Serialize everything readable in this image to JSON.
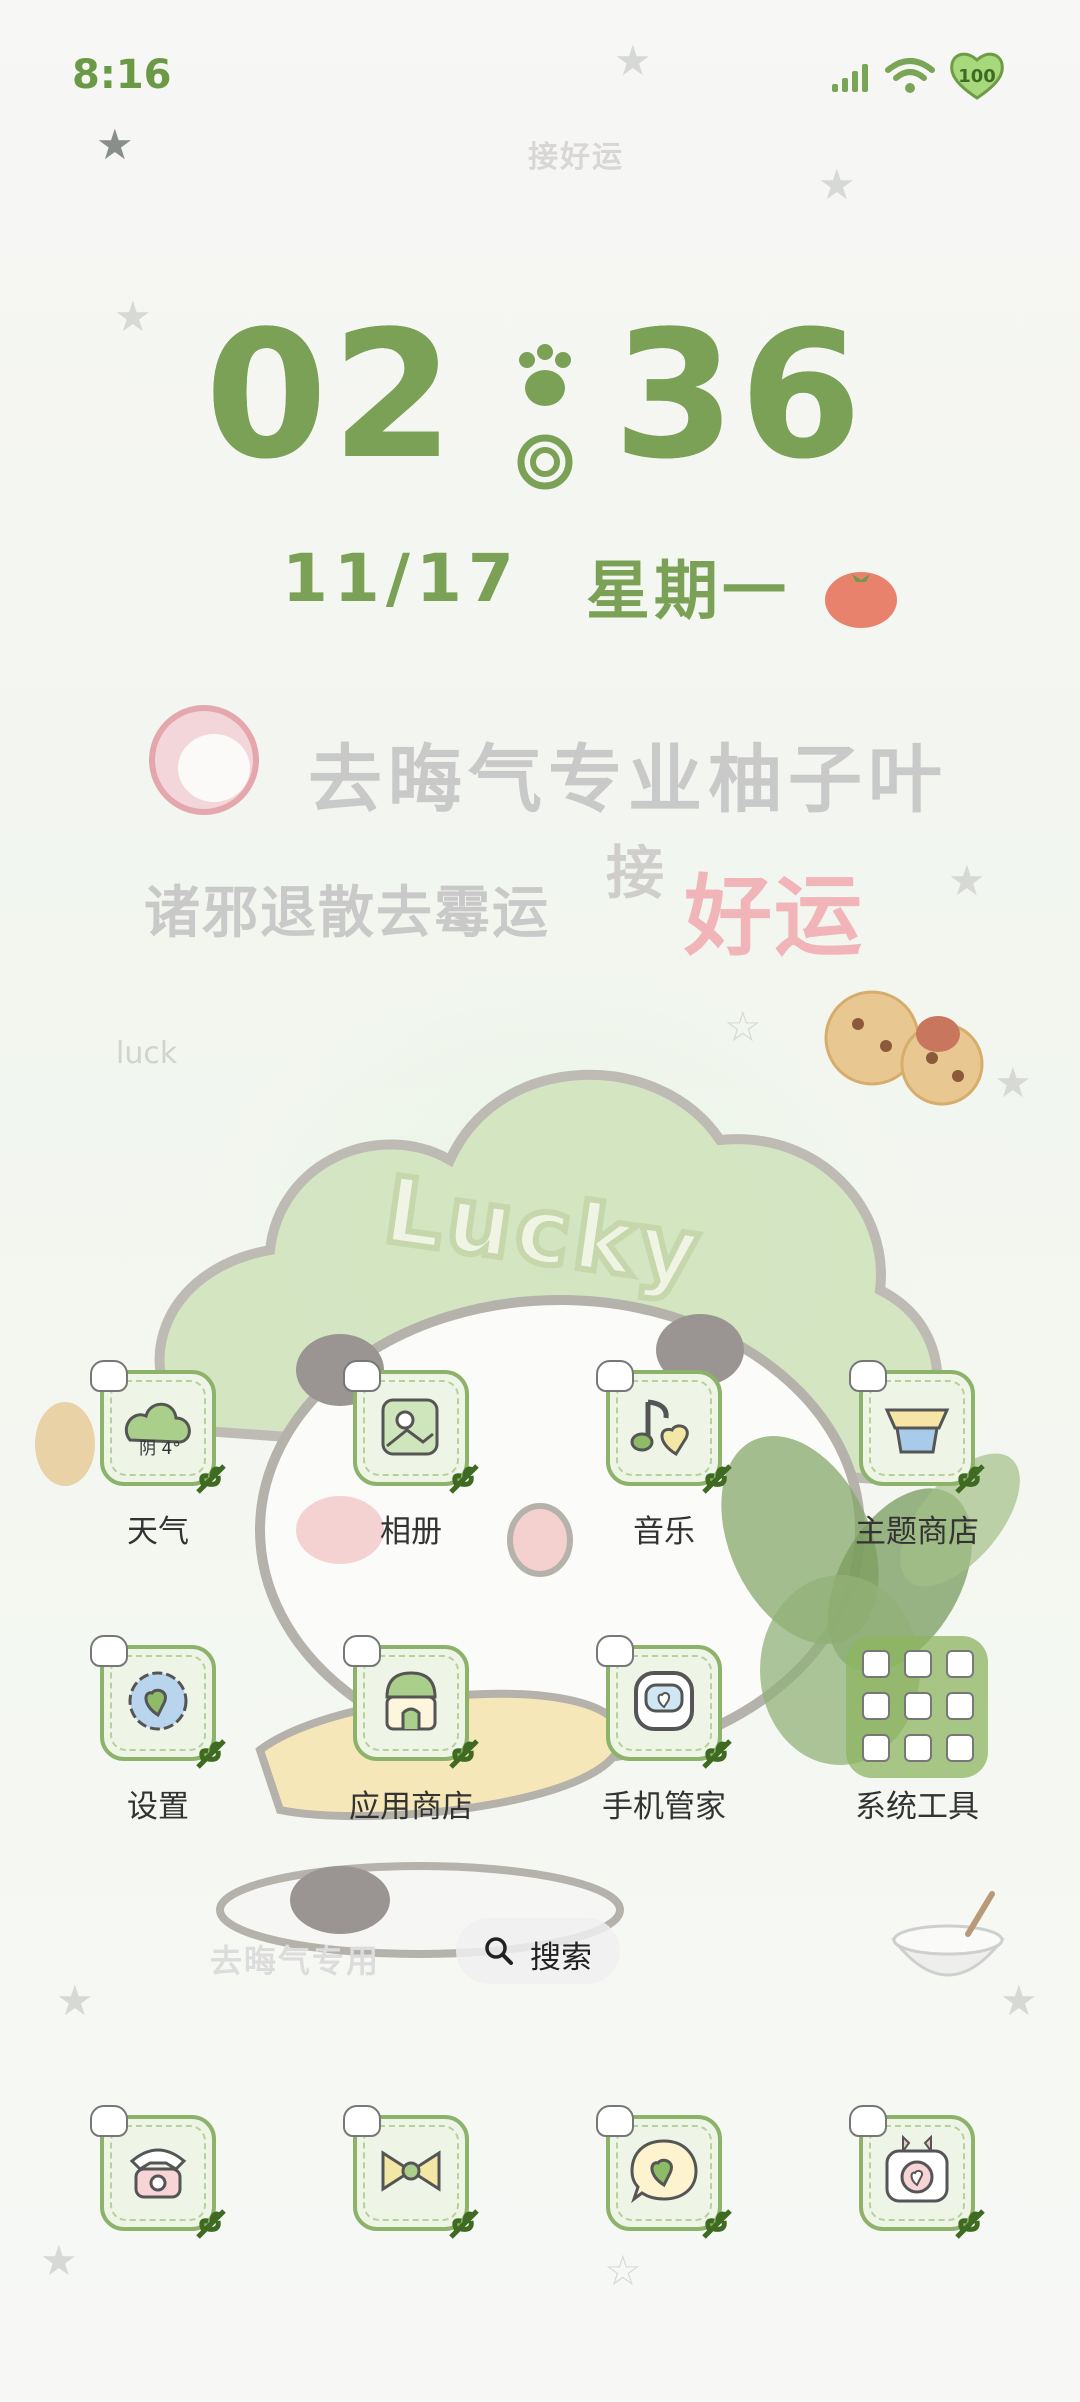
{
  "status_bar": {
    "time": "8:16",
    "battery": "100"
  },
  "wallpaper": {
    "top_text": "接好运",
    "line1": "去晦气专业柚子叶",
    "line2": "诸邪退散去霉运",
    "jie": "接",
    "haoyun": "好运",
    "luck": "luck",
    "lucky": "Lucky",
    "bottom_text": "去晦气专用"
  },
  "clock": {
    "hour": "02",
    "minute": "36",
    "date": "11/17",
    "weekday": "星期一"
  },
  "apps": [
    {
      "label": "天气",
      "icon": "weather-icon",
      "weather": "阴 4°"
    },
    {
      "label": "相册",
      "icon": "gallery-icon"
    },
    {
      "label": "音乐",
      "icon": "music-icon"
    },
    {
      "label": "主题商店",
      "icon": "theme-store-icon"
    },
    {
      "label": "设置",
      "icon": "settings-icon"
    },
    {
      "label": "应用商店",
      "icon": "app-store-icon"
    },
    {
      "label": "手机管家",
      "icon": "phone-manager-icon"
    },
    {
      "label": "系统工具",
      "icon": "system-tools-folder-icon"
    }
  ],
  "search": {
    "label": "搜索"
  },
  "dock": [
    {
      "icon": "phone-icon"
    },
    {
      "icon": "bow-icon"
    },
    {
      "icon": "message-heart-icon"
    },
    {
      "icon": "camera-icon"
    }
  ]
}
